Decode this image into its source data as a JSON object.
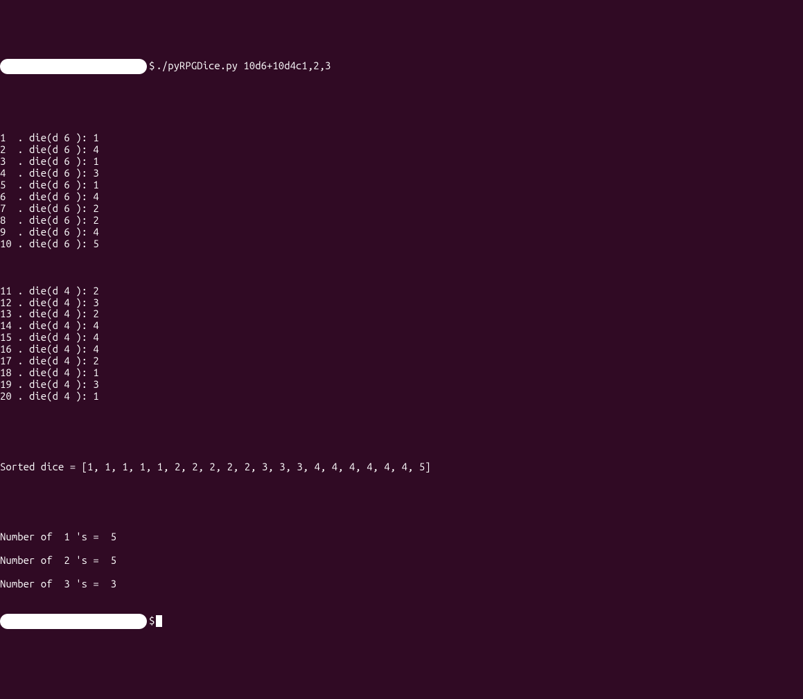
{
  "prompt_symbol": "$",
  "command": "./pyRPGDice.py 10d6+10d4c1,2,3",
  "rolls_d6": [
    {
      "idx": "1 ",
      "type": "d 6 ",
      "val": "1"
    },
    {
      "idx": "2 ",
      "type": "d 6 ",
      "val": "4"
    },
    {
      "idx": "3 ",
      "type": "d 6 ",
      "val": "1"
    },
    {
      "idx": "4 ",
      "type": "d 6 ",
      "val": "3"
    },
    {
      "idx": "5 ",
      "type": "d 6 ",
      "val": "1"
    },
    {
      "idx": "6 ",
      "type": "d 6 ",
      "val": "4"
    },
    {
      "idx": "7 ",
      "type": "d 6 ",
      "val": "2"
    },
    {
      "idx": "8 ",
      "type": "d 6 ",
      "val": "2"
    },
    {
      "idx": "9 ",
      "type": "d 6 ",
      "val": "4"
    },
    {
      "idx": "10",
      "type": "d 6 ",
      "val": "5"
    }
  ],
  "rolls_d4": [
    {
      "idx": "11",
      "type": "d 4 ",
      "val": "2"
    },
    {
      "idx": "12",
      "type": "d 4 ",
      "val": "3"
    },
    {
      "idx": "13",
      "type": "d 4 ",
      "val": "2"
    },
    {
      "idx": "14",
      "type": "d 4 ",
      "val": "4"
    },
    {
      "idx": "15",
      "type": "d 4 ",
      "val": "4"
    },
    {
      "idx": "16",
      "type": "d 4 ",
      "val": "4"
    },
    {
      "idx": "17",
      "type": "d 4 ",
      "val": "2"
    },
    {
      "idx": "18",
      "type": "d 4 ",
      "val": "1"
    },
    {
      "idx": "19",
      "type": "d 4 ",
      "val": "3"
    },
    {
      "idx": "20",
      "type": "d 4 ",
      "val": "1"
    }
  ],
  "sorted_label": "Sorted dice = ",
  "sorted_list": "[1, 1, 1, 1, 1, 2, 2, 2, 2, 2, 3, 3, 3, 4, 4, 4, 4, 4, 4, 5]",
  "counts": [
    {
      "label": "Number of  1 's =  ",
      "val": "5"
    },
    {
      "label": "Number of  2 's =  ",
      "val": "5"
    },
    {
      "label": "Number of  3 's =  ",
      "val": "3"
    }
  ]
}
